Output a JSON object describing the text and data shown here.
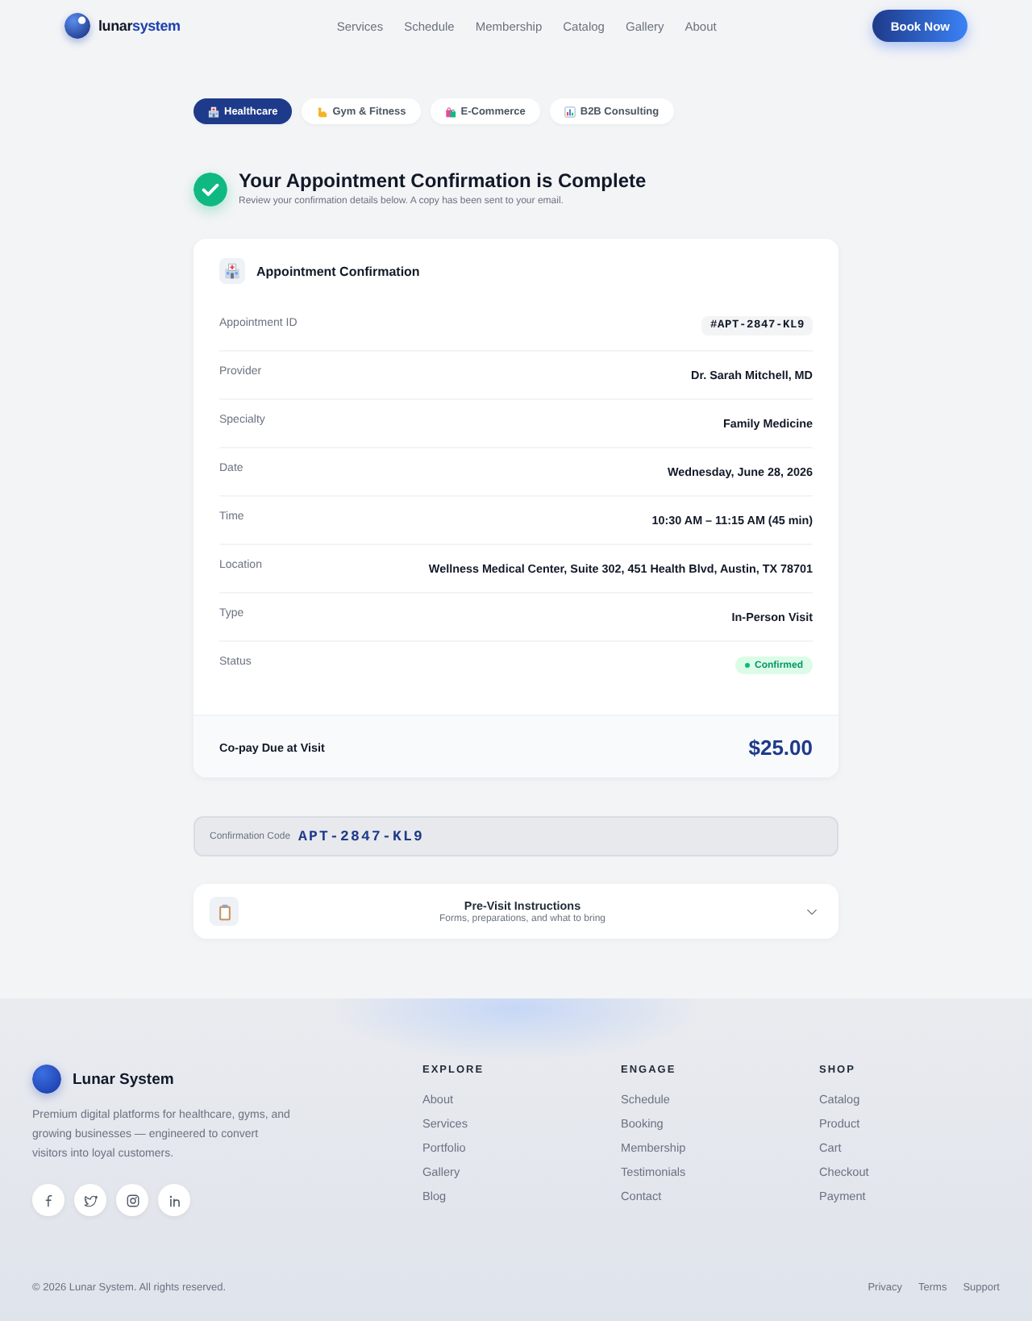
{
  "header": {
    "brand": {
      "first": "lunar",
      "second": "system"
    },
    "nav": [
      "Services",
      "Schedule",
      "Membership",
      "Catalog",
      "Gallery",
      "About"
    ],
    "button": "Book Now"
  },
  "tabs": [
    {
      "label": "Healthcare",
      "selected": true
    },
    {
      "label": "Gym & Fitness",
      "selected": false
    },
    {
      "label": "E-Commerce",
      "selected": false
    },
    {
      "label": "B2B Consulting",
      "selected": false
    }
  ],
  "confirmation": {
    "title": "Your Appointment Confirmation is Complete",
    "subtitle": "Review your confirmation details below. A copy has been sent to your email."
  },
  "details_card": {
    "title": "Appointment Confirmation",
    "rows": [
      {
        "label": "Appointment ID",
        "value": "#APT-2847-KL9",
        "kind": "code"
      },
      {
        "label": "Provider",
        "value": "Dr. Sarah Mitchell, MD",
        "kind": "text"
      },
      {
        "label": "Specialty",
        "value": "Family Medicine",
        "kind": "text"
      },
      {
        "label": "Date",
        "value": "Wednesday, June 28, 2026",
        "kind": "text"
      },
      {
        "label": "Time",
        "value": "10:30 AM – 11:15 AM (45 min)",
        "kind": "text"
      },
      {
        "label": "Location",
        "value": "Wellness Medical Center, Suite 302, 451 Health Blvd, Austin, TX 78701",
        "kind": "text"
      },
      {
        "label": "Type",
        "value": "In-Person Visit",
        "kind": "text"
      },
      {
        "label": "Status",
        "value": "Confirmed",
        "kind": "badge"
      }
    ],
    "total": {
      "label": "Co-pay Due at Visit",
      "amount": "$25.00"
    }
  },
  "confirmation_code": {
    "label": "Confirmation Code",
    "code": "APT-2847-KL9"
  },
  "instructions": {
    "title": "Pre-Visit Instructions",
    "subtitle": "Forms, preparations, and what to bring",
    "expanded": false
  },
  "footer": {
    "brand": "Lunar System",
    "description": "Premium digital platforms for healthcare, gyms, and growing businesses — engineered to convert visitors into loyal customers.",
    "columns": [
      {
        "heading": "EXPLORE",
        "links": [
          "About",
          "Services",
          "Portfolio",
          "Gallery",
          "Blog"
        ]
      },
      {
        "heading": "ENGAGE",
        "links": [
          "Schedule",
          "Booking",
          "Membership",
          "Testimonials",
          "Contact"
        ]
      },
      {
        "heading": "SHOP",
        "links": [
          "Catalog",
          "Product",
          "Cart",
          "Checkout",
          "Payment"
        ]
      }
    ],
    "copyright": "© 2026 Lunar System. All rights reserved.",
    "legal_links": [
      "Privacy",
      "Terms",
      "Support"
    ]
  }
}
